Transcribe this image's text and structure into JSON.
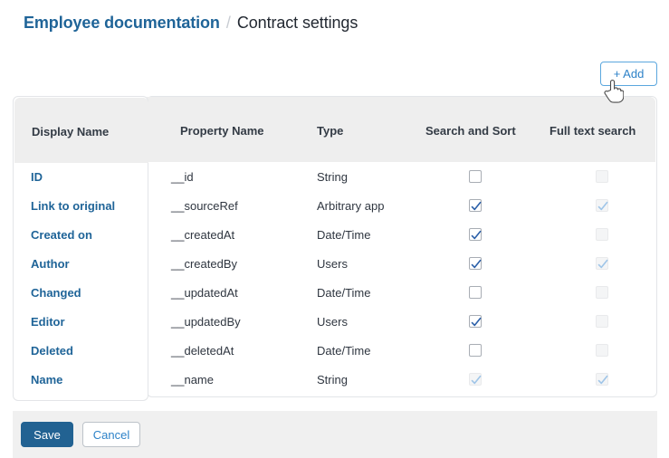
{
  "breadcrumb": {
    "parent": "Employee documentation",
    "separator": "/",
    "current": "Contract settings"
  },
  "toolbar": {
    "add_label": "+ Add"
  },
  "colors": {
    "link": "#1f6498",
    "accent": "#2d82c8",
    "save_bg": "#226292",
    "header_bg": "#eeeeee",
    "footer_bg": "#f0f0f0",
    "check": "#2b5fa8",
    "check_disabled": "#9fc5e8"
  },
  "table": {
    "columns": [
      "Display Name",
      "Property Name",
      "Type",
      "Search and Sort",
      "Full text search"
    ],
    "rows": [
      {
        "display_name": "ID",
        "property_name": "__id",
        "type": "String",
        "search_and_sort": {
          "checked": false,
          "disabled": false
        },
        "full_text_search": {
          "checked": false,
          "disabled": true
        }
      },
      {
        "display_name": "Link to original",
        "property_name": "__sourceRef",
        "type": "Arbitrary app",
        "search_and_sort": {
          "checked": true,
          "disabled": false
        },
        "full_text_search": {
          "checked": true,
          "disabled": true
        }
      },
      {
        "display_name": "Created on",
        "property_name": "__createdAt",
        "type": "Date/Time",
        "search_and_sort": {
          "checked": true,
          "disabled": false
        },
        "full_text_search": {
          "checked": false,
          "disabled": true
        }
      },
      {
        "display_name": "Author",
        "property_name": "__createdBy",
        "type": "Users",
        "search_and_sort": {
          "checked": true,
          "disabled": false
        },
        "full_text_search": {
          "checked": true,
          "disabled": true
        }
      },
      {
        "display_name": "Changed",
        "property_name": "__updatedAt",
        "type": "Date/Time",
        "search_and_sort": {
          "checked": false,
          "disabled": false
        },
        "full_text_search": {
          "checked": false,
          "disabled": true
        }
      },
      {
        "display_name": "Editor",
        "property_name": "__updatedBy",
        "type": "Users",
        "search_and_sort": {
          "checked": true,
          "disabled": false
        },
        "full_text_search": {
          "checked": false,
          "disabled": true
        }
      },
      {
        "display_name": "Deleted",
        "property_name": "__deletedAt",
        "type": "Date/Time",
        "search_and_sort": {
          "checked": false,
          "disabled": false
        },
        "full_text_search": {
          "checked": false,
          "disabled": true
        }
      },
      {
        "display_name": "Name",
        "property_name": "__name",
        "type": "String",
        "search_and_sort": {
          "checked": true,
          "disabled": true
        },
        "full_text_search": {
          "checked": true,
          "disabled": true
        }
      }
    ]
  },
  "footer": {
    "save_label": "Save",
    "cancel_label": "Cancel"
  },
  "cursor": {
    "icon": "pointing-hand-cursor"
  }
}
